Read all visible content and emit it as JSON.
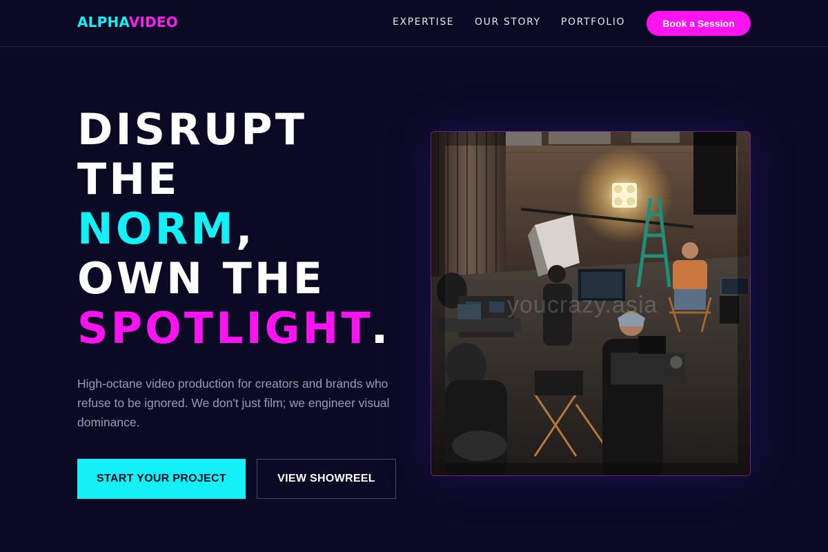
{
  "brand": {
    "part1": "ALPHA",
    "part2": "VIDEO",
    "color1": "#13f1f6",
    "color2": "#ff14f0"
  },
  "nav": {
    "links": [
      "EXPERTISE",
      "OUR STORY",
      "PORTFOLIO"
    ],
    "cta_label": "Book a Session"
  },
  "hero": {
    "headline": {
      "line1": "DISRUPT",
      "line2": "THE",
      "line3": "NORM",
      "line3_punct": ",",
      "line4": "OWN THE",
      "line5": "SPOTLIGHT"
    },
    "subtext": "High-octane video production for creators and brands who refuse to be ignored. We don't just film; we engineer visual dominance.",
    "primary_button": "START YOUR PROJECT",
    "secondary_button": "VIEW SHOWREEL",
    "image_watermark": "youcrazy.asia",
    "image_icon": "film-set-photo-icon"
  },
  "colors": {
    "background": "#0b0a24",
    "accent_cyan": "#13f1f6",
    "accent_pink": "#ff14f0"
  }
}
